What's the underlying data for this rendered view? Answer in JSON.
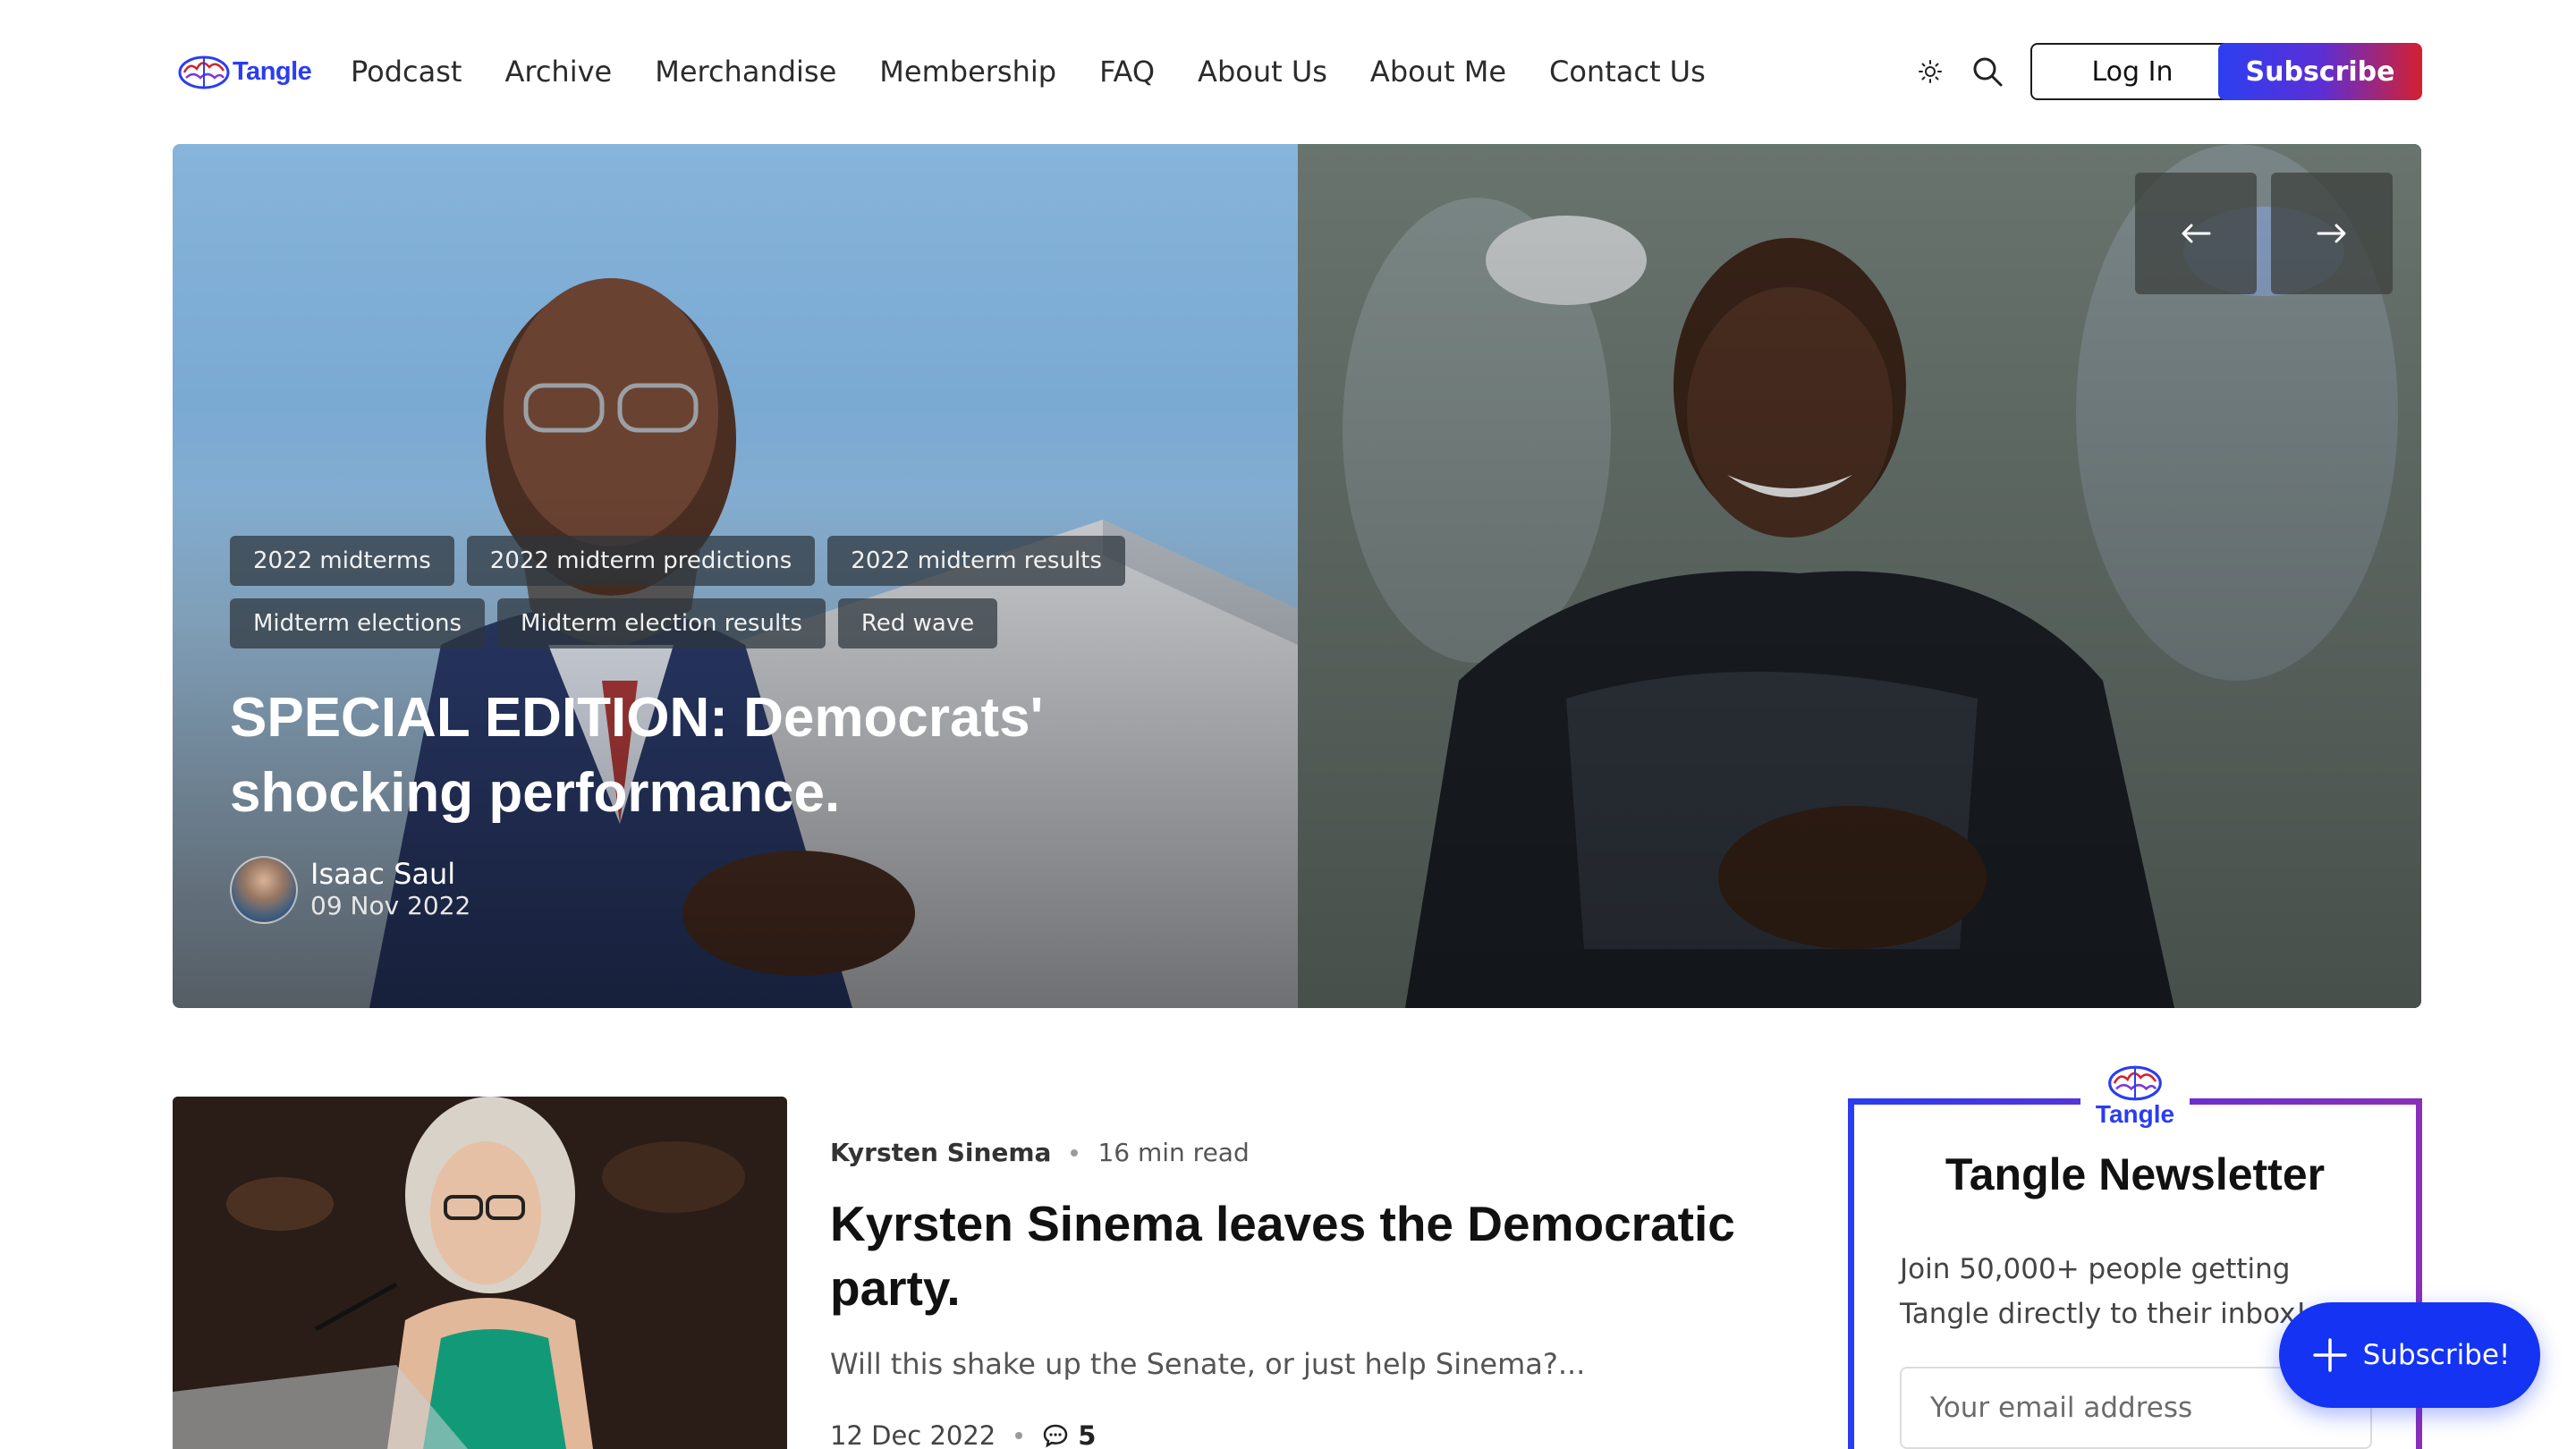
{
  "header": {
    "logo_text": "Tangle",
    "nav": [
      "Podcast",
      "Archive",
      "Merchandise",
      "Membership",
      "FAQ",
      "About Us",
      "About Me",
      "Contact Us"
    ],
    "theme_icon": "sun-icon",
    "search_icon": "search-icon",
    "login_label": "Log In",
    "subscribe_label": "Subscribe"
  },
  "hero": {
    "tags": [
      "2022 midterms",
      "2022 midterm predictions",
      "2022 midterm results",
      "Midterm elections",
      "Midterm election results",
      "Red wave"
    ],
    "title": "SPECIAL EDITION: Democrats' shocking performance.",
    "author": "Isaac Saul",
    "date": "09 Nov 2022",
    "prev_icon": "arrow-left-icon",
    "next_icon": "arrow-right-icon"
  },
  "post": {
    "category": "Kyrsten Sinema",
    "read_time": "16 min read",
    "title": "Kyrsten Sinema leaves the Democratic party.",
    "excerpt": "Will this shake up the Senate, or just help Sinema?...",
    "date": "12 Dec 2022",
    "comments": "5"
  },
  "newsletter": {
    "logo_text": "Tangle",
    "title": "Tangle Newsletter",
    "description": "Join 50,000+ people getting Tangle directly to their inbox!",
    "email_placeholder": "Your email address"
  },
  "fab": {
    "label": "Subscribe!"
  },
  "colors": {
    "brand_blue": "#2a3df0",
    "subscribe_gradient_start": "#2c3ff0",
    "subscribe_gradient_end": "#d42030",
    "fab_blue": "#1433f2"
  }
}
